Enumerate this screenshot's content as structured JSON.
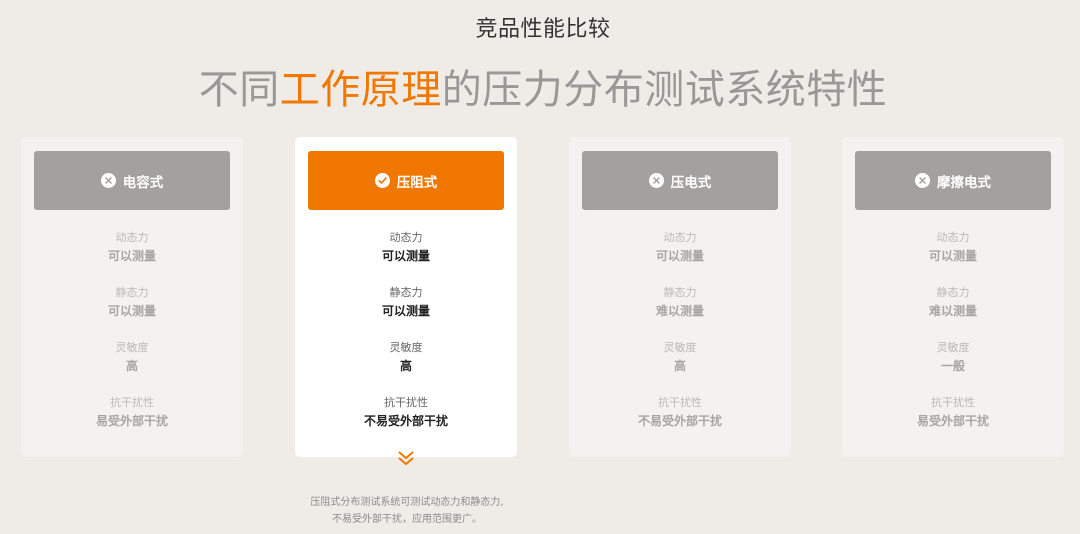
{
  "header": {
    "kicker": "竞品性能比较",
    "headline_before": "不同",
    "headline_accent": "工作原理",
    "headline_after": "的压力分布测试系统特性"
  },
  "colors": {
    "background": "#efece8",
    "accent": "#f07800",
    "inactive_header": "#a3a19f",
    "active_card": "#ffffff",
    "inactive_card": "#f4f2f0"
  },
  "cards": [
    {
      "name": "电容式",
      "selected": false,
      "icon": "x-circle-icon",
      "metrics": [
        {
          "label": "动态力",
          "value": "可以测量"
        },
        {
          "label": "静态力",
          "value": "可以测量"
        },
        {
          "label": "灵敏度",
          "value": "高"
        },
        {
          "label": "抗干扰性",
          "value": "易受外部干扰"
        }
      ]
    },
    {
      "name": "压阻式",
      "selected": true,
      "icon": "check-circle-icon",
      "metrics": [
        {
          "label": "动态力",
          "value": "可以测量"
        },
        {
          "label": "静态力",
          "value": "可以测量"
        },
        {
          "label": "灵敏度",
          "value": "高"
        },
        {
          "label": "抗干扰性",
          "value": "不易受外部干扰"
        }
      ]
    },
    {
      "name": "压电式",
      "selected": false,
      "icon": "x-circle-icon",
      "metrics": [
        {
          "label": "动态力",
          "value": "可以测量"
        },
        {
          "label": "静态力",
          "value": "难以测量"
        },
        {
          "label": "灵敏度",
          "value": "高"
        },
        {
          "label": "抗干扰性",
          "value": "不易受外部干扰"
        }
      ]
    },
    {
      "name": "摩擦电式",
      "selected": false,
      "icon": "x-circle-icon",
      "metrics": [
        {
          "label": "动态力",
          "value": "可以测量"
        },
        {
          "label": "静态力",
          "value": "难以测量"
        },
        {
          "label": "灵敏度",
          "value": "一般"
        },
        {
          "label": "抗干扰性",
          "value": "易受外部干扰"
        }
      ]
    }
  ],
  "footnote": {
    "line1": "压阻式分布测试系统可测试动态力和静态力,",
    "line2": "不易受外部干扰，应用范围更广。"
  }
}
